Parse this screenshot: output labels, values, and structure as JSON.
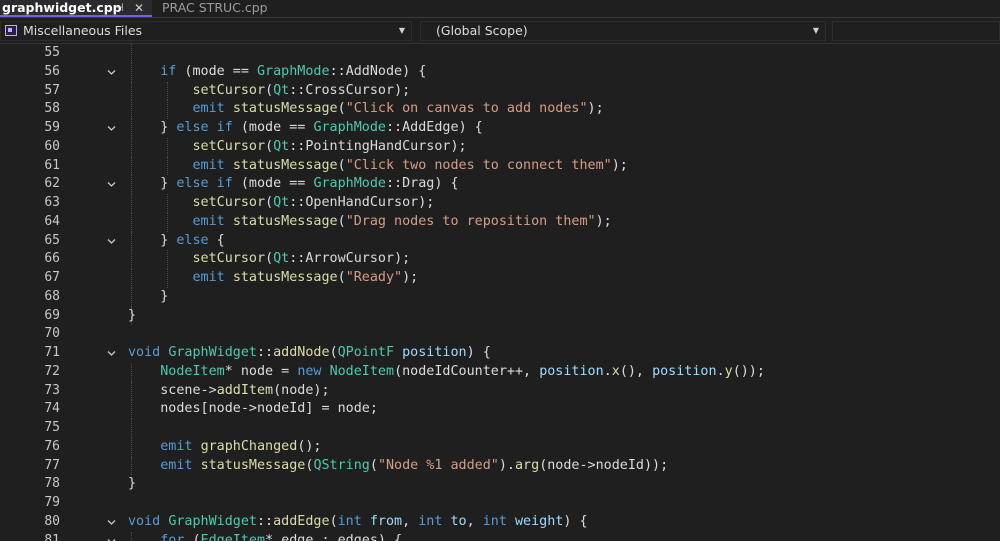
{
  "tabs": [
    {
      "label": "graphwidget.cpp",
      "active": true
    },
    {
      "label": "PRAC STRUC.cpp",
      "active": false
    }
  ],
  "tab_pin_glyph": "⊣",
  "tab_close_glyph": "✕",
  "navbar": {
    "project": "Miscellaneous Files",
    "scope": "(Global Scope)",
    "members": ""
  },
  "colors": {
    "background": "#1f1f1f",
    "keyword": "#569cd6",
    "type": "#4ec9b0",
    "function": "#dcdcaa",
    "string": "#d69d85",
    "text": "#dcdcdc",
    "active_tab_accent": "#7160e8"
  },
  "editor": {
    "lines": [
      {
        "n": "55",
        "fold": false,
        "tokens": []
      },
      {
        "n": "56",
        "fold": true,
        "tokens": [
          [
            "",
            "    "
          ],
          [
            "kw",
            "if"
          ],
          [
            "",
            " (mode == "
          ],
          [
            "ty",
            "GraphMode"
          ],
          [
            "",
            "::"
          ],
          [
            "mb",
            "AddNode"
          ],
          [
            "",
            ") {"
          ]
        ]
      },
      {
        "n": "57",
        "fold": false,
        "tokens": [
          [
            "",
            "        "
          ],
          [
            "fn",
            "setCursor"
          ],
          [
            "",
            "("
          ],
          [
            "ty",
            "Qt"
          ],
          [
            "",
            "::"
          ],
          [
            "mb",
            "CrossCursor"
          ],
          [
            "",
            ");"
          ]
        ]
      },
      {
        "n": "58",
        "fold": false,
        "tokens": [
          [
            "",
            "        "
          ],
          [
            "kw",
            "emit"
          ],
          [
            "",
            " "
          ],
          [
            "fn",
            "statusMessage"
          ],
          [
            "",
            "("
          ],
          [
            "str",
            "\"Click on canvas to add nodes\""
          ],
          [
            "",
            ");"
          ]
        ]
      },
      {
        "n": "59",
        "fold": true,
        "tokens": [
          [
            "",
            "    } "
          ],
          [
            "kw",
            "else if"
          ],
          [
            "",
            " (mode == "
          ],
          [
            "ty",
            "GraphMode"
          ],
          [
            "",
            "::"
          ],
          [
            "mb",
            "AddEdge"
          ],
          [
            "",
            ") {"
          ]
        ]
      },
      {
        "n": "60",
        "fold": false,
        "tokens": [
          [
            "",
            "        "
          ],
          [
            "fn",
            "setCursor"
          ],
          [
            "",
            "("
          ],
          [
            "ty",
            "Qt"
          ],
          [
            "",
            "::"
          ],
          [
            "mb",
            "PointingHandCursor"
          ],
          [
            "",
            ");"
          ]
        ]
      },
      {
        "n": "61",
        "fold": false,
        "tokens": [
          [
            "",
            "        "
          ],
          [
            "kw",
            "emit"
          ],
          [
            "",
            " "
          ],
          [
            "fn",
            "statusMessage"
          ],
          [
            "",
            "("
          ],
          [
            "str",
            "\"Click two nodes to connect them\""
          ],
          [
            "",
            ");"
          ]
        ]
      },
      {
        "n": "62",
        "fold": true,
        "tokens": [
          [
            "",
            "    } "
          ],
          [
            "kw",
            "else if"
          ],
          [
            "",
            " (mode == "
          ],
          [
            "ty",
            "GraphMode"
          ],
          [
            "",
            "::"
          ],
          [
            "mb",
            "Drag"
          ],
          [
            "",
            ") {"
          ]
        ]
      },
      {
        "n": "63",
        "fold": false,
        "tokens": [
          [
            "",
            "        "
          ],
          [
            "fn",
            "setCursor"
          ],
          [
            "",
            "("
          ],
          [
            "ty",
            "Qt"
          ],
          [
            "",
            "::"
          ],
          [
            "mb",
            "OpenHandCursor"
          ],
          [
            "",
            ");"
          ]
        ]
      },
      {
        "n": "64",
        "fold": false,
        "tokens": [
          [
            "",
            "        "
          ],
          [
            "kw",
            "emit"
          ],
          [
            "",
            " "
          ],
          [
            "fn",
            "statusMessage"
          ],
          [
            "",
            "("
          ],
          [
            "str",
            "\"Drag nodes to reposition them\""
          ],
          [
            "",
            ");"
          ]
        ]
      },
      {
        "n": "65",
        "fold": true,
        "tokens": [
          [
            "",
            "    } "
          ],
          [
            "kw",
            "else"
          ],
          [
            "",
            " {"
          ]
        ]
      },
      {
        "n": "66",
        "fold": false,
        "tokens": [
          [
            "",
            "        "
          ],
          [
            "fn",
            "setCursor"
          ],
          [
            "",
            "("
          ],
          [
            "ty",
            "Qt"
          ],
          [
            "",
            "::"
          ],
          [
            "mb",
            "ArrowCursor"
          ],
          [
            "",
            ");"
          ]
        ]
      },
      {
        "n": "67",
        "fold": false,
        "tokens": [
          [
            "",
            "        "
          ],
          [
            "kw",
            "emit"
          ],
          [
            "",
            " "
          ],
          [
            "fn",
            "statusMessage"
          ],
          [
            "",
            "("
          ],
          [
            "str",
            "\"Ready\""
          ],
          [
            "",
            ");"
          ]
        ]
      },
      {
        "n": "68",
        "fold": false,
        "tokens": [
          [
            "",
            "    }"
          ]
        ]
      },
      {
        "n": "69",
        "fold": false,
        "tokens": [
          [
            "",
            "}"
          ]
        ]
      },
      {
        "n": "70",
        "fold": false,
        "tokens": []
      },
      {
        "n": "71",
        "fold": true,
        "tokens": [
          [
            "kw",
            "void"
          ],
          [
            "",
            " "
          ],
          [
            "ty",
            "GraphWidget"
          ],
          [
            "",
            "::"
          ],
          [
            "fn",
            "addNode"
          ],
          [
            "",
            "("
          ],
          [
            "ty",
            "QPointF"
          ],
          [
            "",
            " "
          ],
          [
            "pm",
            "position"
          ],
          [
            "",
            ") {"
          ]
        ]
      },
      {
        "n": "72",
        "fold": false,
        "tokens": [
          [
            "",
            "    "
          ],
          [
            "ty",
            "NodeItem"
          ],
          [
            "",
            "* node = "
          ],
          [
            "kw",
            "new"
          ],
          [
            "",
            " "
          ],
          [
            "ty",
            "NodeItem"
          ],
          [
            "",
            "(nodeIdCounter++, "
          ],
          [
            "pm",
            "position"
          ],
          [
            "",
            "."
          ],
          [
            "fn",
            "x"
          ],
          [
            "",
            "(), "
          ],
          [
            "pm",
            "position"
          ],
          [
            "",
            "."
          ],
          [
            "fn",
            "y"
          ],
          [
            "",
            "());"
          ]
        ]
      },
      {
        "n": "73",
        "fold": false,
        "tokens": [
          [
            "",
            "    scene->"
          ],
          [
            "fn",
            "addItem"
          ],
          [
            "",
            "(node);"
          ]
        ]
      },
      {
        "n": "74",
        "fold": false,
        "tokens": [
          [
            "",
            "    nodes[node->"
          ],
          [
            "mb",
            "nodeId"
          ],
          [
            "",
            "] = node;"
          ]
        ]
      },
      {
        "n": "75",
        "fold": false,
        "tokens": []
      },
      {
        "n": "76",
        "fold": false,
        "tokens": [
          [
            "",
            "    "
          ],
          [
            "kw",
            "emit"
          ],
          [
            "",
            " "
          ],
          [
            "fn",
            "graphChanged"
          ],
          [
            "",
            "();"
          ]
        ]
      },
      {
        "n": "77",
        "fold": false,
        "tokens": [
          [
            "",
            "    "
          ],
          [
            "kw",
            "emit"
          ],
          [
            "",
            " "
          ],
          [
            "fn",
            "statusMessage"
          ],
          [
            "",
            "("
          ],
          [
            "ty",
            "QString"
          ],
          [
            "",
            "("
          ],
          [
            "str",
            "\"Node %1 added\""
          ],
          [
            "",
            ")."
          ],
          [
            "fn",
            "arg"
          ],
          [
            "",
            "(node->"
          ],
          [
            "mb",
            "nodeId"
          ],
          [
            "",
            "));"
          ]
        ]
      },
      {
        "n": "78",
        "fold": false,
        "tokens": [
          [
            "",
            "}"
          ]
        ]
      },
      {
        "n": "79",
        "fold": false,
        "tokens": []
      },
      {
        "n": "80",
        "fold": true,
        "tokens": [
          [
            "kw",
            "void"
          ],
          [
            "",
            " "
          ],
          [
            "ty",
            "GraphWidget"
          ],
          [
            "",
            "::"
          ],
          [
            "fn",
            "addEdge"
          ],
          [
            "",
            "("
          ],
          [
            "kw",
            "int"
          ],
          [
            "",
            " "
          ],
          [
            "pm",
            "from"
          ],
          [
            "",
            ", "
          ],
          [
            "kw",
            "int"
          ],
          [
            "",
            " "
          ],
          [
            "pm",
            "to"
          ],
          [
            "",
            ", "
          ],
          [
            "kw",
            "int"
          ],
          [
            "",
            " "
          ],
          [
            "pm",
            "weight"
          ],
          [
            "",
            ") {"
          ]
        ]
      },
      {
        "n": "81",
        "fold": true,
        "tokens": [
          [
            "",
            "    "
          ],
          [
            "kw",
            "for"
          ],
          [
            "",
            " ("
          ],
          [
            "ty",
            "EdgeItem"
          ],
          [
            "",
            "* edge : edges) {"
          ]
        ]
      }
    ]
  }
}
